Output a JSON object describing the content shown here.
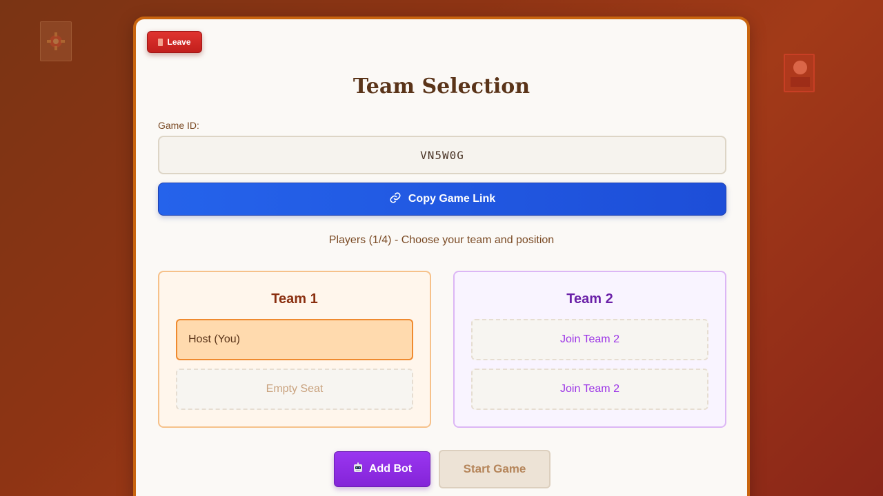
{
  "colors": {
    "accent_orange": "#c9650f",
    "leave_red": "#d22b27",
    "copy_blue": "#2563eb",
    "team1_text": "#8a2f10",
    "team2_text": "#6b21a8",
    "add_bot_purple": "#9333ea"
  },
  "header": {
    "leave_label": "Leave",
    "leave_icon": "door-icon",
    "title": "Team Selection"
  },
  "game": {
    "id_label": "Game ID:",
    "id_value": "VN5W0G",
    "copy_label": "Copy Game Link",
    "copy_icon": "link-icon"
  },
  "players_info": "Players (1/4) - Choose your team and position",
  "teams": [
    {
      "name": "Team 1",
      "seats": [
        {
          "label": "Host (You)",
          "state": "filled"
        },
        {
          "label": "Empty Seat",
          "state": "empty"
        }
      ]
    },
    {
      "name": "Team 2",
      "seats": [
        {
          "label": "Join Team 2",
          "state": "join"
        },
        {
          "label": "Join Team 2",
          "state": "join"
        }
      ]
    }
  ],
  "actions": {
    "add_bot_label": "Add Bot",
    "add_bot_icon": "robot-icon",
    "start_label": "Start Game"
  }
}
